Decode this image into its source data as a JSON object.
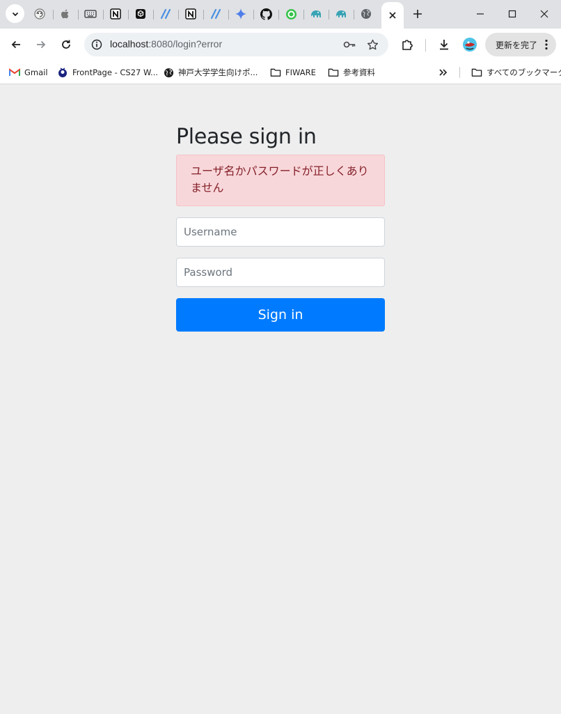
{
  "browser": {
    "address_bar": {
      "host": "localhost",
      "path": ":8080/login?error"
    },
    "update_button_label": "更新を完了",
    "tabs": [
      {
        "icon": "spiral-character-icon"
      },
      {
        "icon": "apple-icon"
      },
      {
        "icon": "keyboard-icon"
      },
      {
        "icon": "notion-icon"
      },
      {
        "icon": "cube-icon"
      },
      {
        "icon": "slash-logo-icon"
      },
      {
        "icon": "notion-icon"
      },
      {
        "icon": "slash-logo-icon"
      },
      {
        "icon": "gemini-sparkle-icon"
      },
      {
        "icon": "github-icon"
      },
      {
        "icon": "green-circle-icon"
      },
      {
        "icon": "elephant-icon"
      },
      {
        "icon": "elephant-icon"
      },
      {
        "icon": "globe-icon"
      },
      {
        "icon": "close-icon"
      }
    ],
    "bookmarks": [
      {
        "label": "Gmail",
        "icon": "gmail-icon"
      },
      {
        "label": "FrontPage - CS27 W...",
        "icon": "site-favicon-icon"
      },
      {
        "label": "神戸大学学生向けポ...",
        "icon": "globe-icon"
      },
      {
        "label": "FIWARE",
        "icon": "folder-icon"
      },
      {
        "label": "参考資料",
        "icon": "folder-icon"
      }
    ],
    "all_bookmarks_label": "すべてのブックマーク"
  },
  "login": {
    "heading": "Please sign in",
    "error_message": "ユーザ名かパスワードが正しくありません",
    "username_placeholder": "Username",
    "password_placeholder": "Password",
    "submit_label": "Sign in"
  },
  "colors": {
    "primary_button": "#007bff",
    "alert_background": "#f8d7da",
    "alert_text": "#842029",
    "page_background": "#eeeeee"
  }
}
